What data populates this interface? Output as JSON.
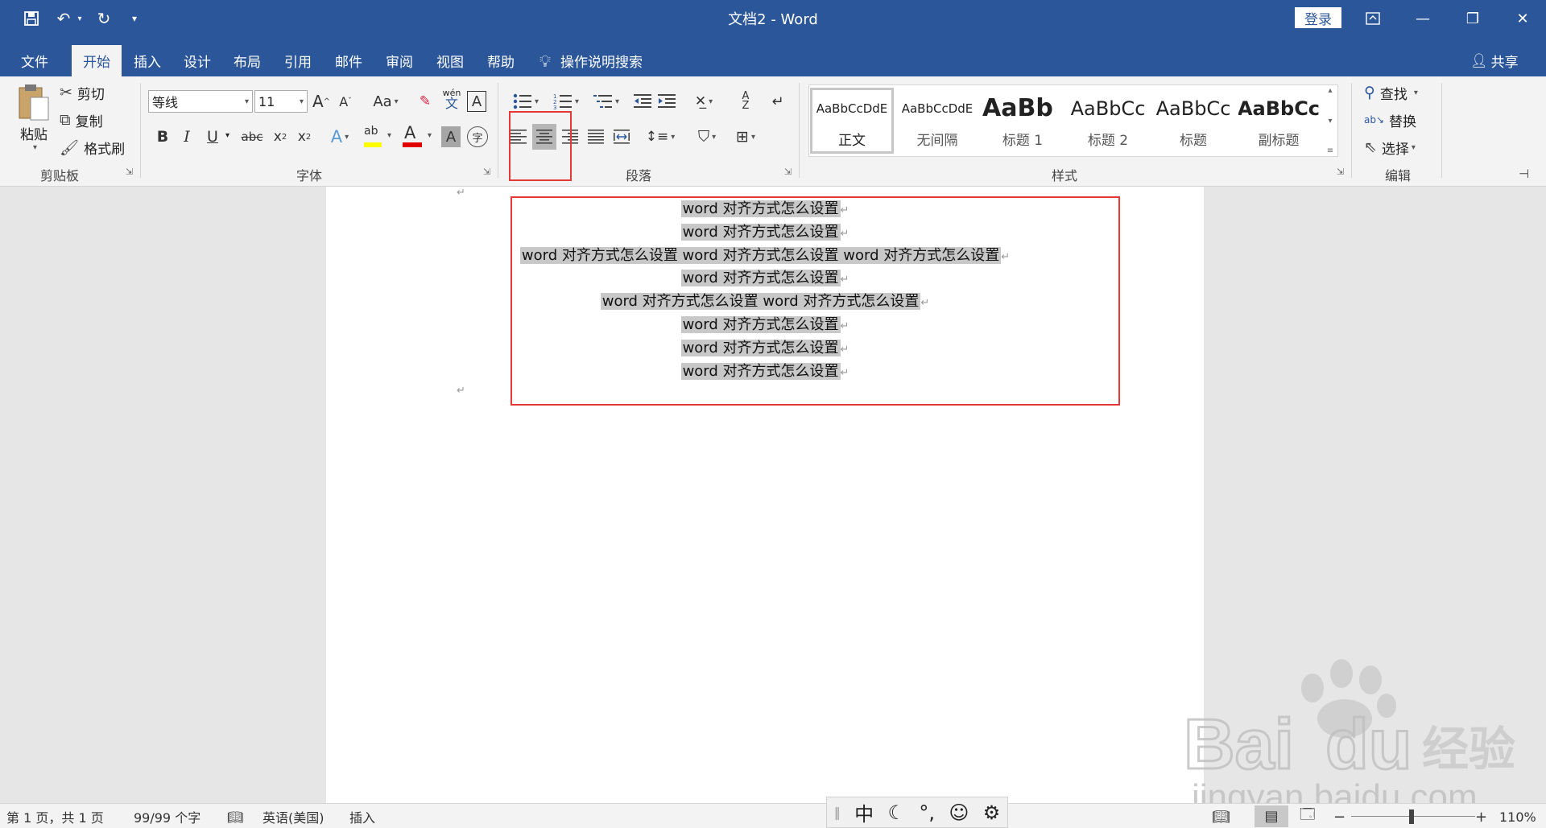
{
  "window": {
    "title": "文档2  -  Word",
    "signin": "登录"
  },
  "qat": {
    "save_icon": "save-icon",
    "undo_icon": "undo-icon",
    "redo_icon": "redo-icon",
    "customize_icon": "customize-icon"
  },
  "tabs": [
    {
      "label": "文件"
    },
    {
      "label": "开始"
    },
    {
      "label": "插入"
    },
    {
      "label": "设计"
    },
    {
      "label": "布局"
    },
    {
      "label": "引用"
    },
    {
      "label": "邮件"
    },
    {
      "label": "审阅"
    },
    {
      "label": "视图"
    },
    {
      "label": "帮助"
    }
  ],
  "tellme": "操作说明搜索",
  "share": "共享",
  "clipboard": {
    "paste": "粘贴",
    "cut": "剪切",
    "copy": "复制",
    "format_painter": "格式刷",
    "label": "剪贴板"
  },
  "font": {
    "name": "等线",
    "size": "11",
    "label": "字体",
    "case_btn": "Aa",
    "phonetic_top": "wén",
    "phonetic_bottom": "文"
  },
  "paragraph": {
    "label": "段落"
  },
  "styles": {
    "label": "样式",
    "items": [
      {
        "sample": "AaBbCcDdE",
        "name": "正文"
      },
      {
        "sample": "AaBbCcDdE",
        "name": "无间隔"
      },
      {
        "sample": "AaBb",
        "name": "标题 1"
      },
      {
        "sample": "AaBbCc",
        "name": "标题 2"
      },
      {
        "sample": "AaBbCc",
        "name": "标题"
      },
      {
        "sample": "AaBbCc",
        "name": "副标题"
      }
    ]
  },
  "editing": {
    "find": "查找",
    "replace": "替换",
    "select": "选择",
    "label": "编辑"
  },
  "document": {
    "lines": [
      "word 对齐方式怎么设置",
      "word 对齐方式怎么设置",
      "word 对齐方式怎么设置 word 对齐方式怎么设置 word 对齐方式怎么设置",
      "word 对齐方式怎么设置",
      "word 对齐方式怎么设置 word 对齐方式怎么设置",
      "word 对齐方式怎么设置",
      "word 对齐方式怎么设置",
      "word 对齐方式怎么设置"
    ]
  },
  "status": {
    "page": "第 1 页，共 1 页",
    "words": "99/99 个字",
    "language": "英语(美国)",
    "mode": "插入",
    "zoom": "110%"
  },
  "ime": {
    "lang": "中"
  },
  "watermark": {
    "brand": "Bai",
    "brand_cn": "经验",
    "url": "jingyan.baidu.com"
  }
}
